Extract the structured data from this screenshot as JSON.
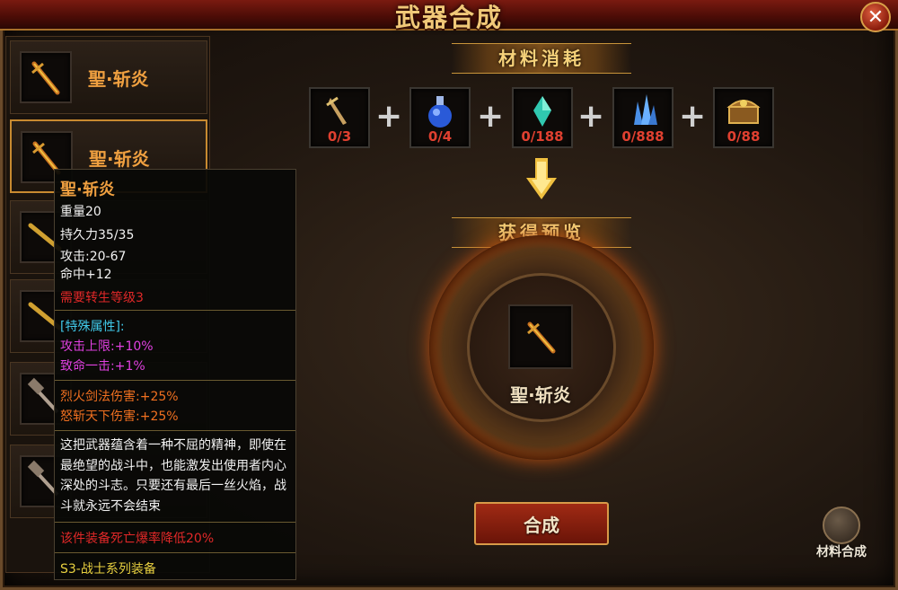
{
  "title": "武器合成",
  "list_items": [
    {
      "name": "聖·斩炎"
    },
    {
      "name": "聖·斩炎"
    }
  ],
  "materials_banner": "材料消耗",
  "materials": [
    {
      "icon": "golden-dagger-icon",
      "count": "0/3"
    },
    {
      "icon": "blue-potion-icon",
      "count": "0/4"
    },
    {
      "icon": "cyan-crystal-icon",
      "count": "0/188"
    },
    {
      "icon": "blue-crystal-cluster-icon",
      "count": "0/888"
    },
    {
      "icon": "treasure-chest-icon",
      "count": "0/88"
    }
  ],
  "preview_banner": "获得预览",
  "result": {
    "name": "聖·斩炎",
    "icon": "flame-sword-icon"
  },
  "synthesize_label": "合成",
  "material_synthesis_label": "材料合成",
  "tooltip": {
    "name": "聖·斩炎",
    "weight": "重量20",
    "durability": "持久力35/35",
    "attack": "攻击:20-67",
    "accuracy": "命中+12",
    "requirement": "需要转生等级3",
    "special_header": "[特殊属性]:",
    "special_1": "攻击上限:+10%",
    "special_2": "致命一击:+1%",
    "bonus_1": "烈火剑法伤害:+25%",
    "bonus_2": "怒斩天下伤害:+25%",
    "description": "这把武器蕴含着一种不屈的精神，即使在最绝望的战斗中，也能激发出使用者内心深处的斗志。只要还有最后一丝火焰，战斗就永远不会结束",
    "drop_note": "该件装备死亡爆率降低20%",
    "set_note": "S3-战士系列装备"
  },
  "colors": {
    "item_name": "#f0a040",
    "requirement": "#e02828",
    "special_header": "#40c8e8",
    "special": "#e040e0",
    "bonus": "#f07020",
    "set": "#e8d040"
  }
}
